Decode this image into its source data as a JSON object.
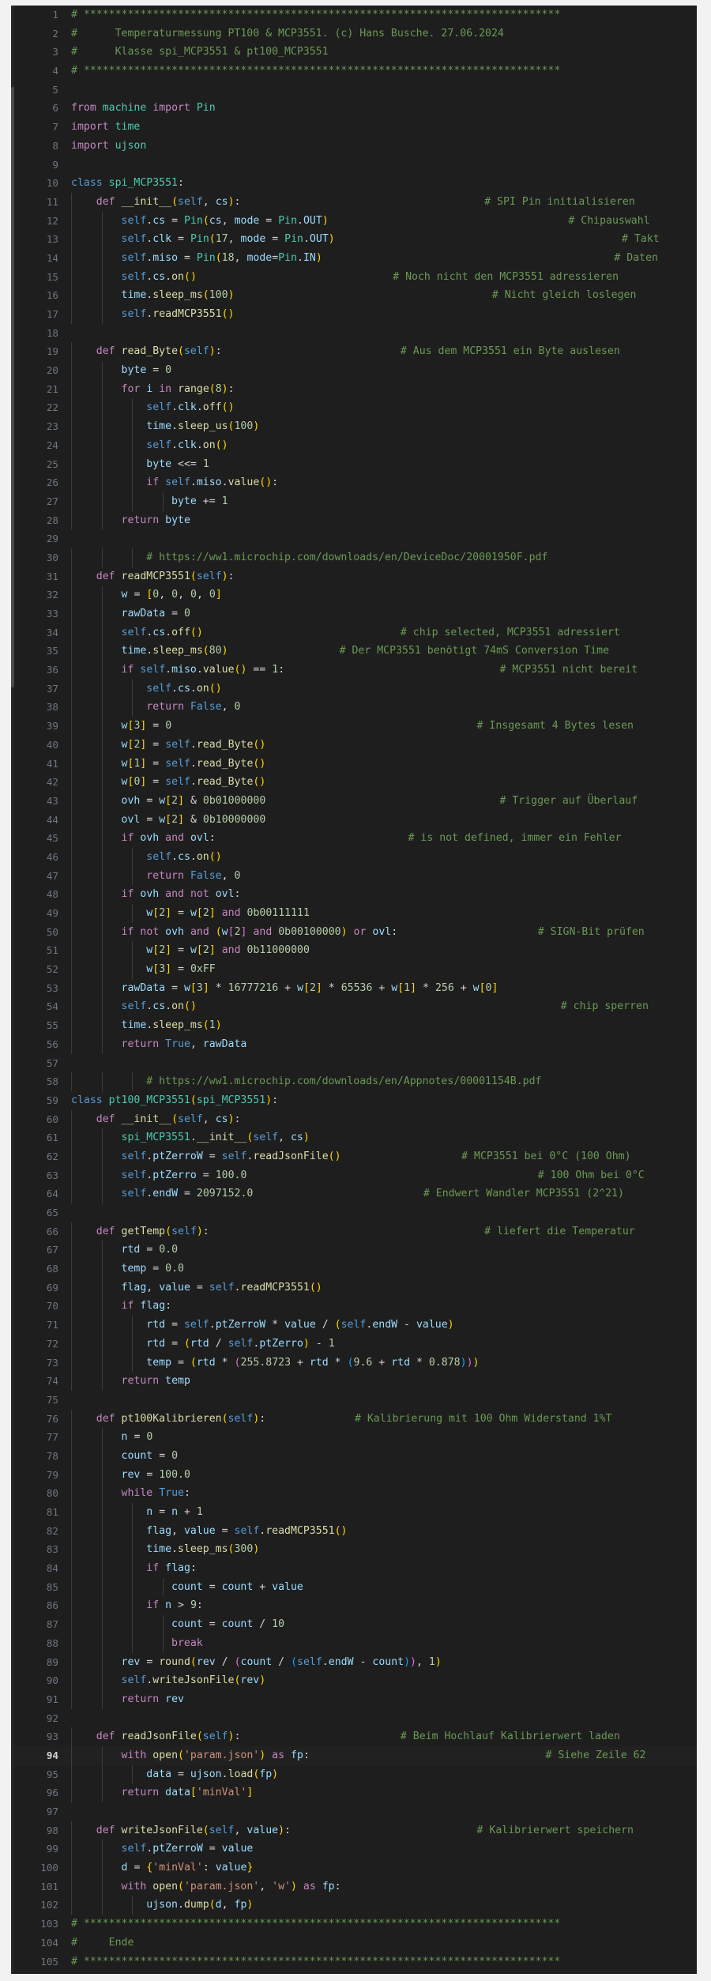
{
  "app": {
    "type": "code-editor",
    "language": "Python",
    "theme": "Dark+ (default dark)",
    "total_lines": 105,
    "active_line": 94
  },
  "colors": {
    "background": "#1e1e1e",
    "active_line": "#212121",
    "line_number": "#6e7681",
    "line_number_active": "#d4d4d4",
    "comment": "#6A9955",
    "keyword": "#C586C0",
    "keyword_blue": "#569CD6",
    "function": "#DCDCAA",
    "class_type": "#4EC9B0",
    "variable": "#9CDCFE",
    "number": "#B5CEA8",
    "string": "#CE9178",
    "operator": "#D4D4D4",
    "bracket_1": "#FFD700",
    "bracket_2": "#DA70D6",
    "bracket_3": "#179FFF",
    "indent_guide": "#3b3b3b",
    "chrome": "#f2f2f2"
  },
  "code_lines": [
    {
      "n": 1,
      "indent": 0,
      "text": "# ****************************************************************************"
    },
    {
      "n": 2,
      "indent": 0,
      "text": "#      Temperaturmessung PT100 & MCP3551. (c) Hans Busche. 27.06.2024"
    },
    {
      "n": 3,
      "indent": 0,
      "text": "#      Klasse spi_MCP3551 & pt100_MCP3551"
    },
    {
      "n": 4,
      "indent": 0,
      "text": "# ****************************************************************************"
    },
    {
      "n": 5,
      "indent": 0,
      "text": ""
    },
    {
      "n": 6,
      "indent": 0,
      "text": "from machine import Pin"
    },
    {
      "n": 7,
      "indent": 0,
      "text": "import time"
    },
    {
      "n": 8,
      "indent": 0,
      "text": "import ujson"
    },
    {
      "n": 9,
      "indent": 0,
      "text": ""
    },
    {
      "n": 10,
      "indent": 0,
      "text": "class spi_MCP3551:"
    },
    {
      "n": 11,
      "indent": 1,
      "text": "    def __init__(self, cs):",
      "comment": "# SPI Pin initialisieren"
    },
    {
      "n": 12,
      "indent": 2,
      "text": "        self.cs = Pin(cs, mode = Pin.OUT)",
      "comment": "# Chipauswahl"
    },
    {
      "n": 13,
      "indent": 2,
      "text": "        self.clk = Pin(17, mode = Pin.OUT)",
      "comment": "# Takt"
    },
    {
      "n": 14,
      "indent": 2,
      "text": "        self.miso = Pin(18, mode=Pin.IN)",
      "comment": "# Daten"
    },
    {
      "n": 15,
      "indent": 2,
      "text": "        self.cs.on()",
      "comment": "# Noch nicht den MCP3551 adressieren"
    },
    {
      "n": 16,
      "indent": 2,
      "text": "        time.sleep_ms(100)",
      "comment": "# Nicht gleich loslegen"
    },
    {
      "n": 17,
      "indent": 2,
      "text": "        self.readMCP3551()"
    },
    {
      "n": 18,
      "indent": 0,
      "text": ""
    },
    {
      "n": 19,
      "indent": 1,
      "text": "    def read_Byte(self):",
      "comment": "# Aus dem MCP3551 ein Byte auslesen"
    },
    {
      "n": 20,
      "indent": 2,
      "text": "        byte = 0"
    },
    {
      "n": 21,
      "indent": 2,
      "text": "        for i in range(8):"
    },
    {
      "n": 22,
      "indent": 3,
      "text": "            self.clk.off()"
    },
    {
      "n": 23,
      "indent": 3,
      "text": "            time.sleep_us(100)"
    },
    {
      "n": 24,
      "indent": 3,
      "text": "            self.clk.on()"
    },
    {
      "n": 25,
      "indent": 3,
      "text": "            byte <<= 1"
    },
    {
      "n": 26,
      "indent": 3,
      "text": "            if self.miso.value():"
    },
    {
      "n": 27,
      "indent": 4,
      "text": "                byte += 1"
    },
    {
      "n": 28,
      "indent": 2,
      "text": "        return byte"
    },
    {
      "n": 29,
      "indent": 0,
      "text": ""
    },
    {
      "n": 30,
      "indent": 3,
      "text": "            # https://ww1.microchip.com/downloads/en/DeviceDoc/20001950F.pdf"
    },
    {
      "n": 31,
      "indent": 1,
      "text": "    def readMCP3551(self):"
    },
    {
      "n": 32,
      "indent": 2,
      "text": "        w = [0, 0, 0, 0]"
    },
    {
      "n": 33,
      "indent": 2,
      "text": "        rawData = 0"
    },
    {
      "n": 34,
      "indent": 2,
      "text": "        self.cs.off()",
      "comment": "# chip selected, MCP3551 adressiert"
    },
    {
      "n": 35,
      "indent": 2,
      "text": "        time.sleep_ms(80)",
      "comment": "# Der MCP3551 benötigt 74mS Conversion Time"
    },
    {
      "n": 36,
      "indent": 2,
      "text": "        if self.miso.value() == 1:",
      "comment": "# MCP3551 nicht bereit"
    },
    {
      "n": 37,
      "indent": 3,
      "text": "            self.cs.on()"
    },
    {
      "n": 38,
      "indent": 3,
      "text": "            return False, 0"
    },
    {
      "n": 39,
      "indent": 2,
      "text": "        w[3] = 0",
      "comment": "# Insgesamt 4 Bytes lesen"
    },
    {
      "n": 40,
      "indent": 2,
      "text": "        w[2] = self.read_Byte()"
    },
    {
      "n": 41,
      "indent": 2,
      "text": "        w[1] = self.read_Byte()"
    },
    {
      "n": 42,
      "indent": 2,
      "text": "        w[0] = self.read_Byte()"
    },
    {
      "n": 43,
      "indent": 2,
      "text": "        ovh = w[2] & 0b01000000",
      "comment": "# Trigger auf Überlauf"
    },
    {
      "n": 44,
      "indent": 2,
      "text": "        ovl = w[2] & 0b10000000"
    },
    {
      "n": 45,
      "indent": 2,
      "text": "        if ovh and ovl:",
      "comment": "# is not defined, immer ein Fehler"
    },
    {
      "n": 46,
      "indent": 3,
      "text": "            self.cs.on()"
    },
    {
      "n": 47,
      "indent": 3,
      "text": "            return False, 0"
    },
    {
      "n": 48,
      "indent": 2,
      "text": "        if ovh and not ovl:"
    },
    {
      "n": 49,
      "indent": 3,
      "text": "            w[2] = w[2] and 0b00111111"
    },
    {
      "n": 50,
      "indent": 2,
      "text": "        if not ovh and (w[2] and 0b00100000) or ovl:",
      "comment": "# SIGN-Bit prüfen"
    },
    {
      "n": 51,
      "indent": 3,
      "text": "            w[2] = w[2] and 0b11000000"
    },
    {
      "n": 52,
      "indent": 3,
      "text": "            w[3] = 0xFF"
    },
    {
      "n": 53,
      "indent": 2,
      "text": "        rawData = w[3] * 16777216 + w[2] * 65536 + w[1] * 256 + w[0]"
    },
    {
      "n": 54,
      "indent": 2,
      "text": "        self.cs.on()",
      "comment": "# chip sperren"
    },
    {
      "n": 55,
      "indent": 2,
      "text": "        time.sleep_ms(1)"
    },
    {
      "n": 56,
      "indent": 2,
      "text": "        return True, rawData"
    },
    {
      "n": 57,
      "indent": 0,
      "text": ""
    },
    {
      "n": 58,
      "indent": 3,
      "text": "            # https://ww1.microchip.com/downloads/en/Appnotes/00001154B.pdf"
    },
    {
      "n": 59,
      "indent": 0,
      "text": "class pt100_MCP3551(spi_MCP3551):"
    },
    {
      "n": 60,
      "indent": 1,
      "text": "    def __init__(self, cs):"
    },
    {
      "n": 61,
      "indent": 2,
      "text": "        spi_MCP3551.__init__(self, cs)"
    },
    {
      "n": 62,
      "indent": 2,
      "text": "        self.ptZerroW = self.readJsonFile()",
      "comment": "# MCP3551 bei 0°C (100 Ohm)"
    },
    {
      "n": 63,
      "indent": 2,
      "text": "        self.ptZerro = 100.0",
      "comment": "# 100 Ohm bei 0°C"
    },
    {
      "n": 64,
      "indent": 2,
      "text": "        self.endW = 2097152.0",
      "comment": "# Endwert Wandler MCP3551 (2^21)"
    },
    {
      "n": 65,
      "indent": 0,
      "text": ""
    },
    {
      "n": 66,
      "indent": 1,
      "text": "    def getTemp(self):",
      "comment": "# liefert die Temperatur"
    },
    {
      "n": 67,
      "indent": 2,
      "text": "        rtd = 0.0"
    },
    {
      "n": 68,
      "indent": 2,
      "text": "        temp = 0.0"
    },
    {
      "n": 69,
      "indent": 2,
      "text": "        flag, value = self.readMCP3551()"
    },
    {
      "n": 70,
      "indent": 2,
      "text": "        if flag:"
    },
    {
      "n": 71,
      "indent": 3,
      "text": "            rtd = self.ptZerroW * value / (self.endW - value)"
    },
    {
      "n": 72,
      "indent": 3,
      "text": "            rtd = (rtd / self.ptZerro) - 1"
    },
    {
      "n": 73,
      "indent": 3,
      "text": "            temp = (rtd * (255.8723 + rtd * (9.6 + rtd * 0.878)))"
    },
    {
      "n": 74,
      "indent": 2,
      "text": "        return temp"
    },
    {
      "n": 75,
      "indent": 0,
      "text": ""
    },
    {
      "n": 76,
      "indent": 1,
      "text": "    def pt100Kalibrieren(self):",
      "comment": "# Kalibrierung mit 100 Ohm Widerstand 1%T"
    },
    {
      "n": 77,
      "indent": 2,
      "text": "        n = 0"
    },
    {
      "n": 78,
      "indent": 2,
      "text": "        count = 0"
    },
    {
      "n": 79,
      "indent": 2,
      "text": "        rev = 100.0"
    },
    {
      "n": 80,
      "indent": 2,
      "text": "        while True:"
    },
    {
      "n": 81,
      "indent": 3,
      "text": "            n = n + 1"
    },
    {
      "n": 82,
      "indent": 3,
      "text": "            flag, value = self.readMCP3551()"
    },
    {
      "n": 83,
      "indent": 3,
      "text": "            time.sleep_ms(300)"
    },
    {
      "n": 84,
      "indent": 3,
      "text": "            if flag:"
    },
    {
      "n": 85,
      "indent": 4,
      "text": "                count = count + value"
    },
    {
      "n": 86,
      "indent": 3,
      "text": "            if n > 9:"
    },
    {
      "n": 87,
      "indent": 4,
      "text": "                count = count / 10"
    },
    {
      "n": 88,
      "indent": 4,
      "text": "                break"
    },
    {
      "n": 89,
      "indent": 2,
      "text": "        rev = round(rev / (count / (self.endW - count)), 1)"
    },
    {
      "n": 90,
      "indent": 2,
      "text": "        self.writeJsonFile(rev)"
    },
    {
      "n": 91,
      "indent": 2,
      "text": "        return rev"
    },
    {
      "n": 92,
      "indent": 0,
      "text": ""
    },
    {
      "n": 93,
      "indent": 1,
      "text": "    def readJsonFile(self):",
      "comment": "# Beim Hochlauf Kalibrierwert laden"
    },
    {
      "n": 94,
      "indent": 2,
      "text": "        with open('param.json') as fp:",
      "comment": "# Siehe Zeile 62",
      "active": true
    },
    {
      "n": 95,
      "indent": 3,
      "text": "            data = ujson.load(fp)"
    },
    {
      "n": 96,
      "indent": 2,
      "text": "        return data['minVal']"
    },
    {
      "n": 97,
      "indent": 0,
      "text": ""
    },
    {
      "n": 98,
      "indent": 1,
      "text": "    def writeJsonFile(self, value):",
      "comment": "# Kalibrierwert speichern"
    },
    {
      "n": 99,
      "indent": 2,
      "text": "        self.ptZerroW = value"
    },
    {
      "n": 100,
      "indent": 2,
      "text": "        d = {'minVal': value}"
    },
    {
      "n": 101,
      "indent": 2,
      "text": "        with open('param.json', 'w') as fp:"
    },
    {
      "n": 102,
      "indent": 3,
      "text": "            ujson.dump(d, fp)"
    },
    {
      "n": 103,
      "indent": 0,
      "text": "# ****************************************************************************"
    },
    {
      "n": 104,
      "indent": 0,
      "text": "#     Ende"
    },
    {
      "n": 105,
      "indent": 0,
      "text": "# ****************************************************************************"
    }
  ]
}
